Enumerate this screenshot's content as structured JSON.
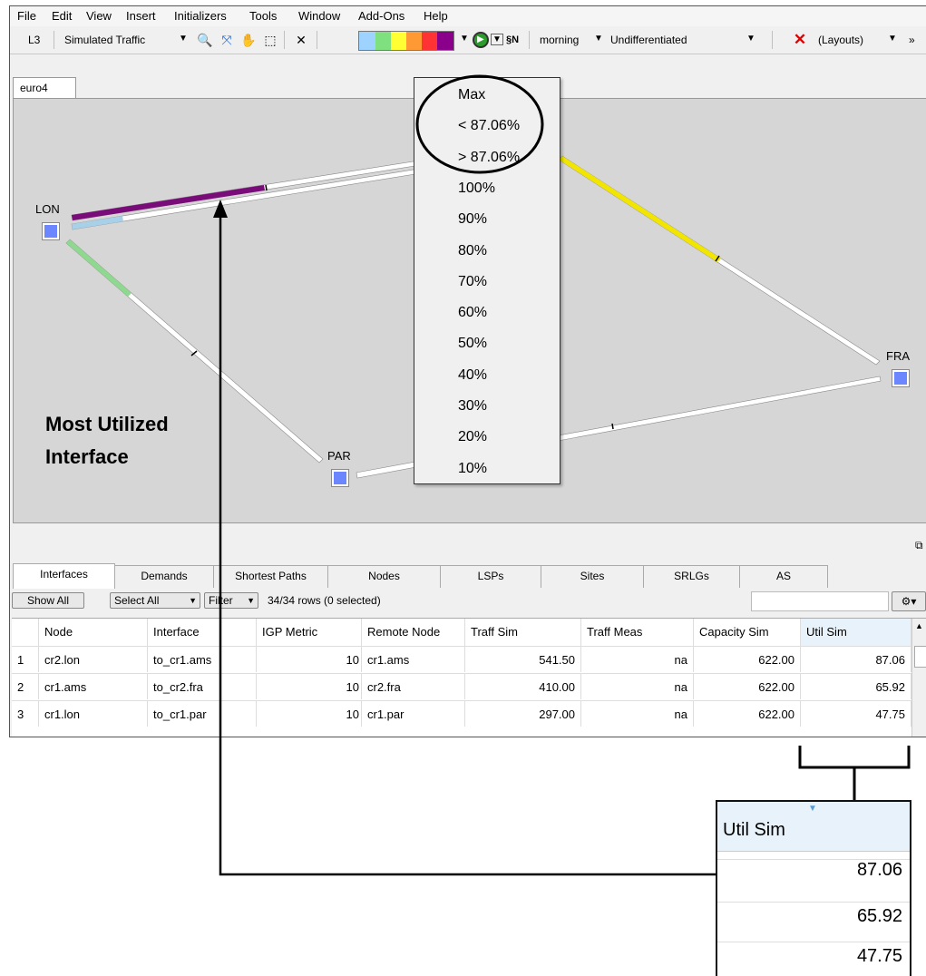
{
  "menu": [
    "File",
    "Edit",
    "View",
    "Insert",
    "Initializers",
    "Tools",
    "Window",
    "Add-Ons",
    "Help"
  ],
  "toolbar": {
    "layer": "L3",
    "traffic": "Simulated Traffic",
    "time": "morning",
    "mode": "Undifferentiated",
    "layouts": "(Layouts)",
    "more": "»",
    "icons": [
      "zoom-icon",
      "fit-icon",
      "pan-hand-icon",
      "select-icon",
      "network-icon",
      "color-scale-icon",
      "play-icon",
      "sort-icon",
      "delete-icon"
    ],
    "scale_colors": [
      "#9fd3ff",
      "#7fe07f",
      "#ffff33",
      "#ff9933",
      "#ff3333",
      "#8b008b"
    ]
  },
  "document_tab": "euro4",
  "map": {
    "nodes": [
      "LON",
      "FRA",
      "PAR"
    ],
    "colors": {
      "purple": "#7a0c7a",
      "light_blue": "#a8d0e8",
      "green": "#8fd88f",
      "yellow": "#f2e600",
      "node": "#6c86ff"
    }
  },
  "dropdown": {
    "items": [
      "Max",
      "< 87.06%",
      "> 87.06%",
      "100%",
      "90%",
      "80%",
      "70%",
      "60%",
      "50%",
      "40%",
      "30%",
      "20%",
      "10%"
    ]
  },
  "annotation": {
    "line1": "Most Utilized",
    "line2": "Interface"
  },
  "bottom_tabs": [
    "Interfaces",
    "Demands",
    "Shortest Paths",
    "Nodes",
    "LSPs",
    "Sites",
    "SRLGs",
    "AS"
  ],
  "filter_bar": {
    "show_all": "Show All",
    "select_all": "Select All",
    "filter": "Filter",
    "row_count": "34/34 rows (0 selected)"
  },
  "table": {
    "columns": [
      "Node",
      "Interface",
      "IGP Metric",
      "Remote Node",
      "Traff Sim",
      "Traff Meas",
      "Capacity Sim",
      "Util Sim"
    ],
    "rows": [
      {
        "num": "1",
        "node": "cr2.lon",
        "interface": "to_cr1.ams",
        "igp": "10",
        "remote": "cr1.ams",
        "traff_sim": "541.50",
        "traff_meas": "na",
        "capacity": "622.00",
        "util": "87.06"
      },
      {
        "num": "2",
        "node": "cr1.ams",
        "interface": "to_cr2.fra",
        "igp": "10",
        "remote": "cr2.fra",
        "traff_sim": "410.00",
        "traff_meas": "na",
        "capacity": "622.00",
        "util": "65.92"
      },
      {
        "num": "3",
        "node": "cr1.lon",
        "interface": "to_cr1.par",
        "igp": "10",
        "remote": "cr1.par",
        "traff_sim": "297.00",
        "traff_meas": "na",
        "capacity": "622.00",
        "util": "47.75"
      }
    ]
  },
  "zoom": {
    "header": "Util Sim",
    "values": [
      "87.06",
      "65.92",
      "47.75"
    ]
  }
}
